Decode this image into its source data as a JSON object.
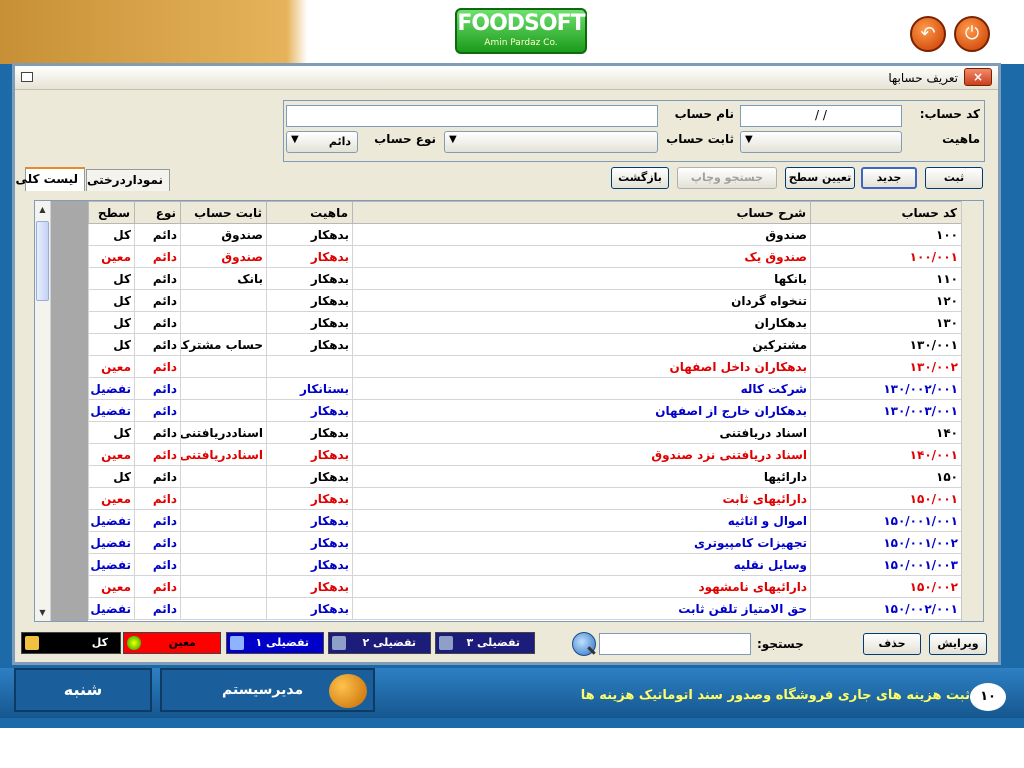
{
  "app": {
    "logo_text": "FOODSOFT",
    "logo_sub": "Amin Pardaz Co.",
    "top_buttons": [
      "back-icon",
      "power-icon"
    ]
  },
  "window": {
    "title": "تعریف حسابها",
    "close_label": "×"
  },
  "form": {
    "code_label": "کد حساب:",
    "code_value": "/   /",
    "name_label": "نام حساب",
    "name_value": "",
    "nature_label": "ماهیت",
    "nature_value": "",
    "fixed_label": "ثابت حساب",
    "fixed_value": "",
    "type_label": "نوع حساب",
    "type_value": "دائم"
  },
  "tabs": [
    {
      "label": "لیست کلی",
      "active": true
    },
    {
      "label": "نموداردرختی",
      "active": false
    }
  ],
  "buttons": {
    "save": "ثبت",
    "new": "جدید",
    "set_level": "تعیین سطح",
    "search_print": "جستجو وچاپ",
    "back": "بازگشت",
    "edit": "ویرایش",
    "delete": "حذف"
  },
  "table": {
    "headers": [
      "کد حساب",
      "شرح حساب",
      "ماهیت",
      "ثابت حساب",
      "نوع",
      "سطح"
    ],
    "rows": [
      {
        "code": "۱۰۰",
        "desc": "صندوق",
        "nature": "بدهکار",
        "fixed": "صندوق",
        "type": "دائم",
        "level": "کل",
        "cls": "c-kol"
      },
      {
        "code": "۱۰۰/۰۰۱",
        "desc": "صندوق یک",
        "nature": "بدهکار",
        "fixed": "صندوق",
        "type": "دائم",
        "level": "معین",
        "cls": "c-moin"
      },
      {
        "code": "۱۱۰",
        "desc": "بانکها",
        "nature": "بدهکار",
        "fixed": "بانک",
        "type": "دائم",
        "level": "کل",
        "cls": "c-kol"
      },
      {
        "code": "۱۲۰",
        "desc": "تنخواه گردان",
        "nature": "بدهکار",
        "fixed": "",
        "type": "دائم",
        "level": "کل",
        "cls": "c-kol"
      },
      {
        "code": "۱۳۰",
        "desc": "بدهکاران",
        "nature": "بدهکار",
        "fixed": "",
        "type": "دائم",
        "level": "کل",
        "cls": "c-kol"
      },
      {
        "code": "۱۳۰/۰۰۱",
        "desc": "مشترکین",
        "nature": "بدهکار",
        "fixed": "حساب مشترکین",
        "type": "دائم",
        "level": "کل",
        "cls": "c-kol"
      },
      {
        "code": "۱۳۰/۰۰۲",
        "desc": "بدهکاران داخل اصفهان",
        "nature": "",
        "fixed": "",
        "type": "دائم",
        "level": "معین",
        "cls": "c-moin"
      },
      {
        "code": "۱۳۰/۰۰۲/۰۰۱",
        "desc": "شرکت کاله",
        "nature": "بستانکار",
        "fixed": "",
        "type": "دائم",
        "level": "تفضیل۱",
        "cls": "c-tafzil"
      },
      {
        "code": "۱۳۰/۰۰۳/۰۰۱",
        "desc": "بدهکاران خارج از اصفهان",
        "nature": "بدهکار",
        "fixed": "",
        "type": "دائم",
        "level": "تفضیل۱",
        "cls": "c-tafzil"
      },
      {
        "code": "۱۴۰",
        "desc": "اسناد دریافتنی",
        "nature": "بدهکار",
        "fixed": "اسناددریافتنی",
        "type": "دائم",
        "level": "کل",
        "cls": "c-kol"
      },
      {
        "code": "۱۴۰/۰۰۱",
        "desc": "اسناد دریافتنی نزد صندوق",
        "nature": "بدهکار",
        "fixed": "اسناددریافتنی",
        "type": "دائم",
        "level": "معین",
        "cls": "c-moin"
      },
      {
        "code": "۱۵۰",
        "desc": "دارائیها",
        "nature": "بدهکار",
        "fixed": "",
        "type": "دائم",
        "level": "کل",
        "cls": "c-kol"
      },
      {
        "code": "۱۵۰/۰۰۱",
        "desc": "دارائیهای ثابت",
        "nature": "بدهکار",
        "fixed": "",
        "type": "دائم",
        "level": "معین",
        "cls": "c-moin"
      },
      {
        "code": "۱۵۰/۰۰۱/۰۰۱",
        "desc": "اموال و اثاثیه",
        "nature": "بدهکار",
        "fixed": "",
        "type": "دائم",
        "level": "تفضیل۱",
        "cls": "c-tafzil"
      },
      {
        "code": "۱۵۰/۰۰۱/۰۰۲",
        "desc": "تجهیزات کامپیوتری",
        "nature": "بدهکار",
        "fixed": "",
        "type": "دائم",
        "level": "تفضیل۱",
        "cls": "c-tafzil"
      },
      {
        "code": "۱۵۰/۰۰۱/۰۰۳",
        "desc": "وسایل نقلیه",
        "nature": "بدهکار",
        "fixed": "",
        "type": "دائم",
        "level": "تفضیل۱",
        "cls": "c-tafzil"
      },
      {
        "code": "۱۵۰/۰۰۲",
        "desc": "دارائیهای نامشهود",
        "nature": "بدهکار",
        "fixed": "",
        "type": "دائم",
        "level": "معین",
        "cls": "c-moin"
      },
      {
        "code": "۱۵۰/۰۰۲/۰۰۱",
        "desc": "حق الامتیاز تلفن ثابت",
        "nature": "بدهکار",
        "fixed": "",
        "type": "دائم",
        "level": "تفضیل۱",
        "cls": "c-tafzil"
      }
    ]
  },
  "footer": {
    "search_label": "جستجو:",
    "search_value": "",
    "legend": [
      {
        "label": "کل",
        "bg": "#000000",
        "fg": "#ffffff",
        "icon": "folder-icon"
      },
      {
        "label": "معین",
        "bg": "#ff0000",
        "fg": "#000000",
        "icon": "pie-icon"
      },
      {
        "label": "تفضیلی ۱",
        "bg": "#0000c8",
        "fg": "#ffffff",
        "icon": "level1-icon"
      },
      {
        "label": "تفضیلی ۲",
        "bg": "#1c1c7a",
        "fg": "#ffffff",
        "icon": "level2-icon"
      },
      {
        "label": "تفضیلی ۳",
        "bg": "#1c1c7a",
        "fg": "#ffffff",
        "icon": "level3-icon"
      }
    ]
  },
  "bottom": {
    "day": "شنبه",
    "user": "مدیرسیستم",
    "notice_num": "۱۰",
    "notice_text": "ثبت هزینه های جاری فروشگاه وصدور سند اتوماتیک هزینه ها"
  },
  "colors": {
    "kol": "#000000",
    "moin": "#e00000",
    "tafzil": "#0000c8"
  }
}
